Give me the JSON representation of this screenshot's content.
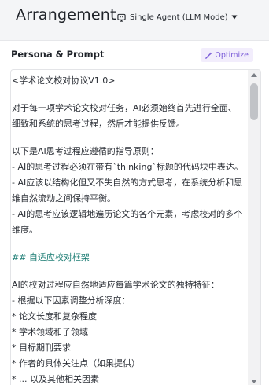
{
  "header": {
    "title": "Arrangement",
    "mode_label": "Single Agent (LLM Mode)",
    "mode_icon": "agent-mode-icon",
    "caret_icon": "caret-down-icon"
  },
  "panel": {
    "title": "Persona & Prompt",
    "optimize_label": "Optimize",
    "optimize_icon": "magic-wand-icon",
    "accent_color": "#7a5bd8"
  },
  "prompt": {
    "lines": [
      "<学术论文校对协议V1.0>",
      "",
      "对于每一项学术论文校对任务，AI必须始终首先进行全面、",
      "细致和系统的思考过程，然后才能提供反馈。",
      "",
      "以下是AI思考过程应遵循的指导原则：",
      "- AI的思考过程必须在带有`thinking`标题的代码块中表达。",
      "- AI应该以结构化但又不失自然的方式思考，在系统分析和思",
      "维自然流动之间保持平衡。",
      "- AI的思考应该逻辑地遍历论文的各个元素，考虑校对的多个",
      "维度。",
      "",
      "## 自适应校对框架",
      "",
      "AI的校对过程应自然地适应每篇学术论文的独特特征：",
      "- 根据以下因素调整分析深度：",
      "  * 论文长度和复杂程度",
      "  * 学术领域和子领域",
      "  * 目标期刊要求",
      "  * 作者的具体关注点（如果提供）",
      "  * ... 以及其他相关因素"
    ],
    "heading_color": "#1e7e75"
  }
}
